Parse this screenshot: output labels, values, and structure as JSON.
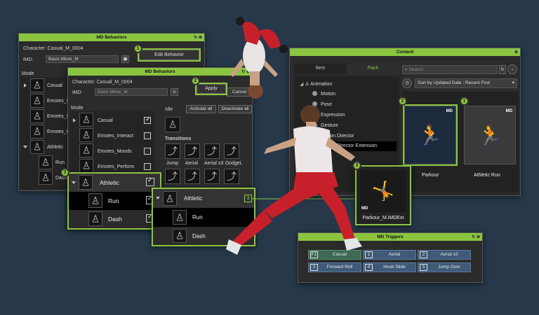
{
  "md_back": {
    "title": "MD Behaviors",
    "character": "Character: Casual_M_0004",
    "imd_label": "iMD:",
    "imd_value": "Basic Move_M",
    "mode_label": "Mode",
    "edit_behavior": "Edit Behavior",
    "modes": [
      "Casual",
      "Emotes_I",
      "Emotes_I",
      "Emotes_I",
      "Athletic",
      "Run",
      "Dash"
    ]
  },
  "md_front": {
    "title": "MD Behaviors",
    "character": "Character: Casual_M_0004",
    "imd_label": "iMD:",
    "imd_value": "Basic Move_M",
    "apply": "Apply",
    "cancel": "Cancel",
    "mode_label": "Mode",
    "idle_label": "Idle",
    "activate_all": "Activate all",
    "deactivate_all": "Deactivate all",
    "transitions_label": "Transitions",
    "modes": [
      "Casual",
      "Emotes_Interact",
      "Emotes_Moods",
      "Emotes_Perform"
    ],
    "transitions": [
      "Jump",
      "Aerial",
      "Aerial x3",
      "DodgeL"
    ]
  },
  "zoom_mode": {
    "athletic": "Athletic",
    "run": "Run",
    "dash": "Dash"
  },
  "zoom_transition": {
    "athletic": "Athletic",
    "run": "Run",
    "dash": "Dash",
    "count": "3"
  },
  "content": {
    "title": "Content",
    "tab_item": "Item",
    "tab_pack": "Pack",
    "search_placeholder": "Search",
    "sort": "Sort by Updated Date : Recent First",
    "tree": [
      "Animation",
      "Motion",
      "Pose",
      "Expression",
      "Gesture",
      "Motion Director",
      "Motion Director Extension"
    ],
    "cards": [
      {
        "label": "Parkour"
      },
      {
        "label": "Athletic Run"
      }
    ]
  },
  "imdext": {
    "label": "Parkour_M.iMDExt"
  },
  "triggers": {
    "title": "MD Triggers",
    "items": [
      {
        "key": "F1",
        "name": "Casual"
      },
      {
        "key": "1",
        "name": "Aerial"
      },
      {
        "key": "2",
        "name": "Aerial x3"
      },
      {
        "key": "3",
        "name": "Forward Roll"
      },
      {
        "key": "4",
        "name": "Hook Slide"
      },
      {
        "key": "5",
        "name": "Jump Over"
      }
    ]
  },
  "badges": [
    "1",
    "2",
    "3",
    "2",
    "1",
    "3"
  ],
  "colors": {
    "accent": "#8bc53f",
    "background": "#27384a",
    "panel": "#2b2b2b",
    "trigger_blue": "#3f5a78"
  }
}
